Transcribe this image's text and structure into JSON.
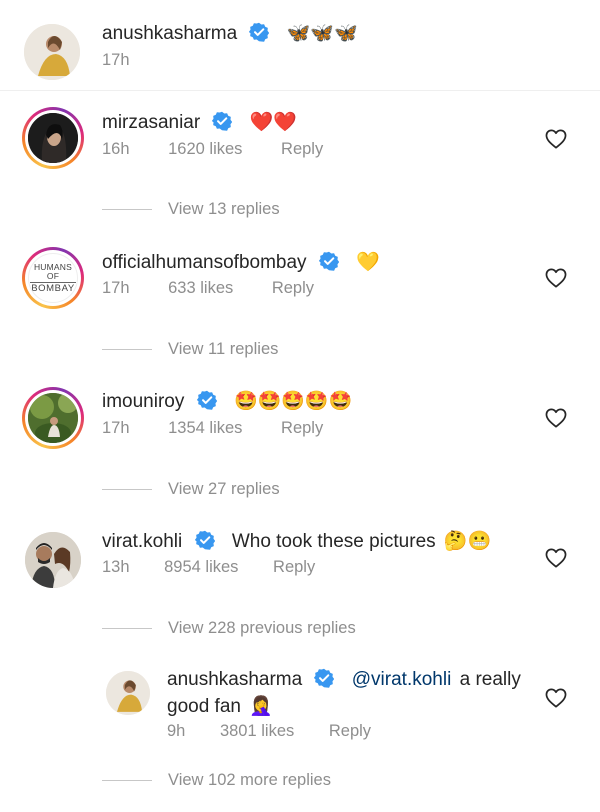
{
  "caption": {
    "username": "anushkasharma",
    "text": "🦋🦋🦋",
    "time": "17h"
  },
  "comments": [
    {
      "username": "mirzasaniar",
      "text": "❤️❤️",
      "time": "16h",
      "likes": "1620 likes",
      "reply_label": "Reply",
      "view_replies": "View 13 replies"
    },
    {
      "username": "officialhumansofbombay",
      "text": "💛",
      "time": "17h",
      "likes": "633 likes",
      "reply_label": "Reply",
      "view_replies": "View 11 replies",
      "avatar_text_top": "HUMANS OF",
      "avatar_text_bottom": "BOMBAY"
    },
    {
      "username": "imouniroy",
      "text": "🤩🤩🤩🤩🤩",
      "time": "17h",
      "likes": "1354 likes",
      "reply_label": "Reply",
      "view_replies": "View 27 replies"
    },
    {
      "username": "virat.kohli",
      "text": "Who took these pictures",
      "emoji": "🤔😬",
      "time": "13h",
      "likes": "8954 likes",
      "reply_label": "Reply",
      "view_replies": "View 228 previous replies"
    }
  ],
  "nested_reply": {
    "username": "anushkasharma",
    "mention": "@virat.kohli",
    "text_line1": "a really",
    "text_line2": "good fan",
    "emoji": "🤦‍♀️",
    "time": "9h",
    "likes": "3801 likes",
    "reply_label": "Reply",
    "view_replies": "View 102 more replies"
  },
  "colors": {
    "text": "#262626",
    "meta": "#8e8e8e",
    "verified": "#3897f0",
    "mention": "#00376b"
  }
}
